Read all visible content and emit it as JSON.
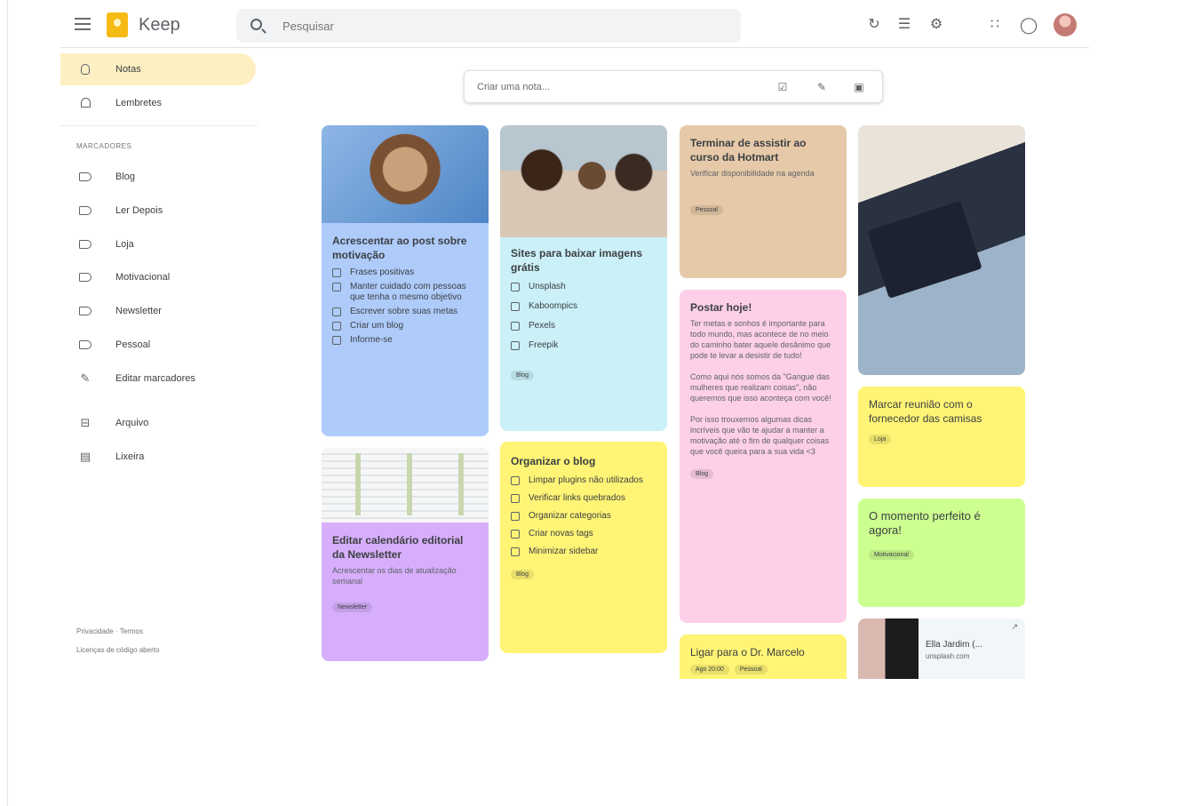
{
  "app": {
    "name": "Keep"
  },
  "search": {
    "placeholder": "Pesquisar"
  },
  "header_icons": [
    "refresh-icon",
    "list-view-icon",
    "settings-icon",
    "apps-grid-icon",
    "account-circle-icon",
    "avatar"
  ],
  "sidebar": {
    "items": [
      {
        "label": "Notas",
        "icon": "lightbulb-icon",
        "active": true
      },
      {
        "label": "Lembretes",
        "icon": "bell-icon"
      }
    ],
    "section_heading": "MARCADORES",
    "labels": [
      "Blog",
      "Ler Depois",
      "Loja",
      "Motivacional",
      "Newsletter",
      "Pessoal"
    ],
    "edit_labels": "Editar marcadores",
    "archive": "Arquivo",
    "trash": "Lixeira",
    "footer_line1": "Privacidade · Termos",
    "footer_line2": "Licenças de código aberto"
  },
  "create_note": {
    "placeholder": "Criar uma nota..."
  },
  "colors": {
    "blue": "#aecbfa",
    "teal": "#cbf0f8",
    "brown": "#e6c9a8",
    "pink": "#fdcfe8",
    "yellow": "#fff475",
    "green": "#ccff90",
    "purple": "#d7aefb"
  },
  "notes": {
    "motivacao": {
      "title": "Acrescentar ao post sobre motivação",
      "items": [
        "Frases positivas",
        "Manter cuidado com pessoas que tenha o mesmo objetivo",
        "Escrever sobre suas metas",
        "Criar um blog",
        "Informe-se"
      ]
    },
    "newsletter": {
      "title": "Editar calendário editorial da Newsletter",
      "body": "Acrescentar os dias de atualização semanal",
      "label": "Newsletter"
    },
    "sites": {
      "title": "Sites para baixar imagens grátis",
      "items": [
        "Unsplash",
        "Kaboompics",
        "Pexels",
        "Freepik"
      ],
      "label": "Blog"
    },
    "organizar": {
      "title": "Organizar o blog",
      "items": [
        "Limpar plugins não utilizados",
        "Verificar links quebrados",
        "Organizar categorias",
        "Criar novas tags",
        "Minimizar sidebar"
      ],
      "label": "Blog"
    },
    "curso": {
      "title": "Terminar de assistir ao curso da Hotmart",
      "body": "Verificar disponibilidade na agenda",
      "label": "Pessoal"
    },
    "postar": {
      "title": "Postar hoje!",
      "body": "Ter metas e sonhos é importante para todo mundo, mas acontece de no meio do caminho bater aquele desânimo que pode te levar a desistir de tudo!\n\nComo aqui nós somos da \"Gangue das mulheres que realizam coisas\", não queremos que isso aconteça com você!\n\nPor isso trouxemos algumas dicas incríveis que vão te ajudar a manter a motivação até o fim de qualquer coisas que você queira para a sua vida <3",
      "label": "Blog"
    },
    "ligar": {
      "title": "Ligar para o Dr. Marcelo",
      "reminder": "Ago 20:00",
      "label": "Pessoal"
    },
    "reuniao": {
      "title": "Marcar reunião com o fornecedor das camisas",
      "label": "Loja"
    },
    "momento": {
      "title": "O momento perfeito é agora!",
      "label": "Motivacional"
    },
    "link": {
      "title": "Ella Jardim (...",
      "url": "unsplash.com"
    }
  }
}
